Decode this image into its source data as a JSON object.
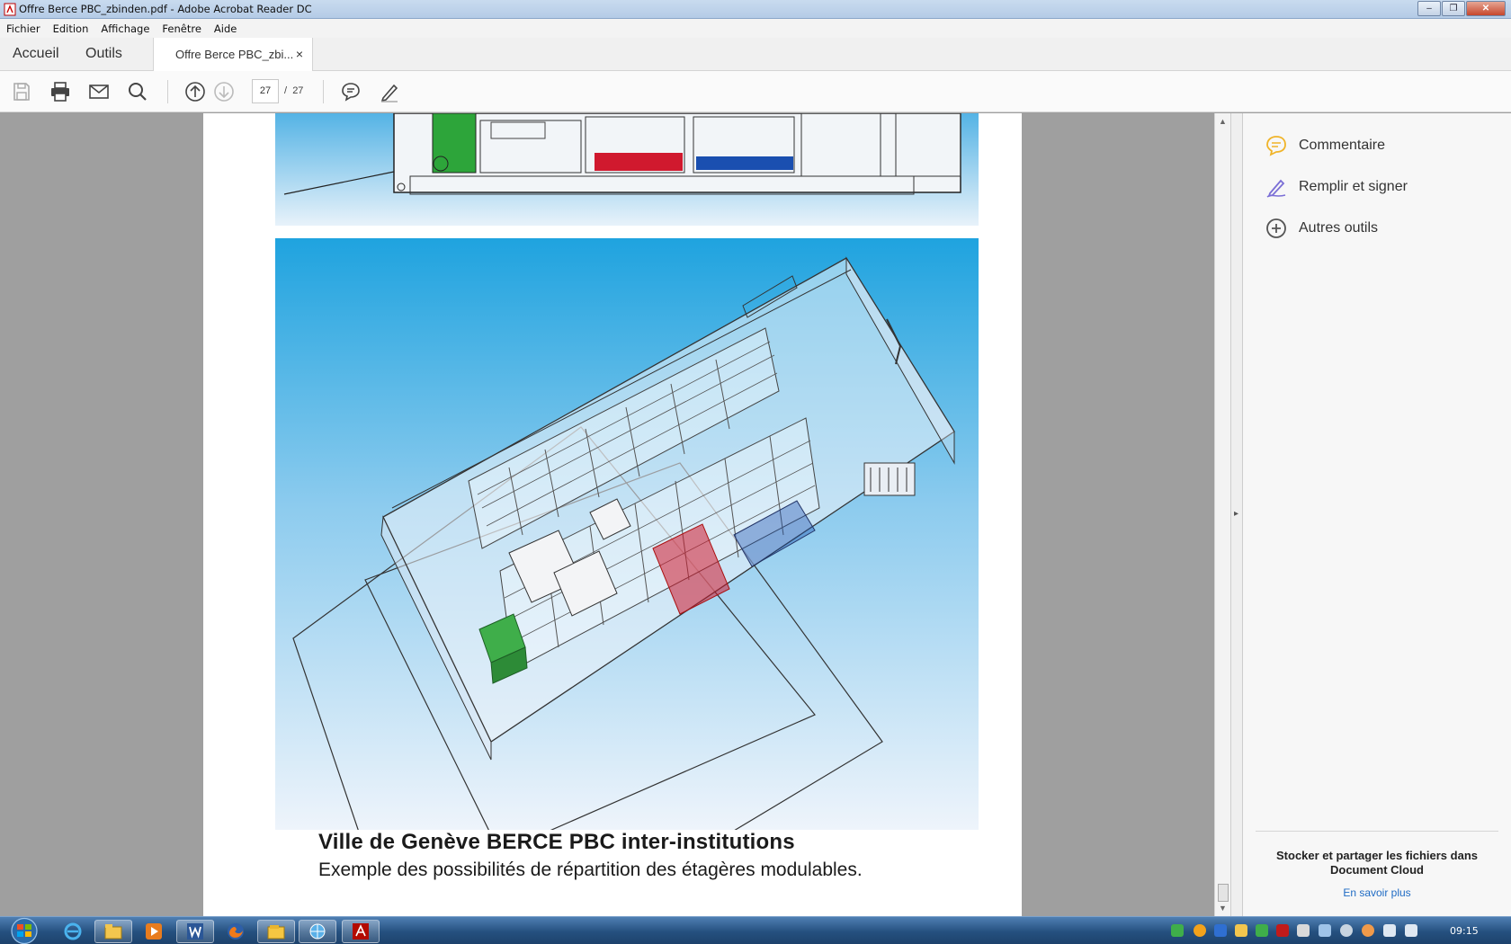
{
  "window": {
    "title": "Offre Berce PBC_zbinden.pdf - Adobe Acrobat Reader DC",
    "controls": {
      "minimize": "–",
      "restore": "❐",
      "close": "✕"
    }
  },
  "menu": [
    "Fichier",
    "Edition",
    "Affichage",
    "Fenêtre",
    "Aide"
  ],
  "tabs": {
    "home": "Accueil",
    "tools": "Outils",
    "document": "Offre Berce PBC_zbi...",
    "close": "×"
  },
  "toolbar": {
    "page_current": "27",
    "page_separator": "/",
    "page_total": "27",
    "icons": [
      "save-icon",
      "print-icon",
      "email-icon",
      "search-icon",
      "page-up-icon",
      "page-down-icon",
      "comment-icon",
      "pen-icon"
    ]
  },
  "document": {
    "caption_title": "Ville de Genève BERCE PBC inter-institutions",
    "caption_subtitle": "Exemple des possibilités de répartition des étagères modulables."
  },
  "right_pane": {
    "items": [
      {
        "label": "Commentaire",
        "icon": "comment-icon",
        "color": "#f0b429"
      },
      {
        "label": "Remplir et signer",
        "icon": "fill-sign-icon",
        "color": "#7b6fd6"
      },
      {
        "label": "Autres outils",
        "icon": "plus-circle-icon",
        "color": "#555555"
      }
    ],
    "cloud_text": "Stocker et partager les fichiers dans Document Cloud",
    "cloud_link": "En savoir plus"
  },
  "taskbar": {
    "clock": "09:15",
    "apps": [
      "internet-explorer-icon",
      "file-explorer-icon",
      "media-player-icon",
      "word-icon",
      "firefox-icon",
      "folder-icon",
      "network-icon",
      "acrobat-icon"
    ]
  },
  "colors": {
    "accent_blue": "#1f6bc4",
    "shelf_red": "#d0192e",
    "shelf_blue": "#1a4fb0",
    "cabinet_green": "#2fa23a",
    "sky": "#36a9e0"
  }
}
